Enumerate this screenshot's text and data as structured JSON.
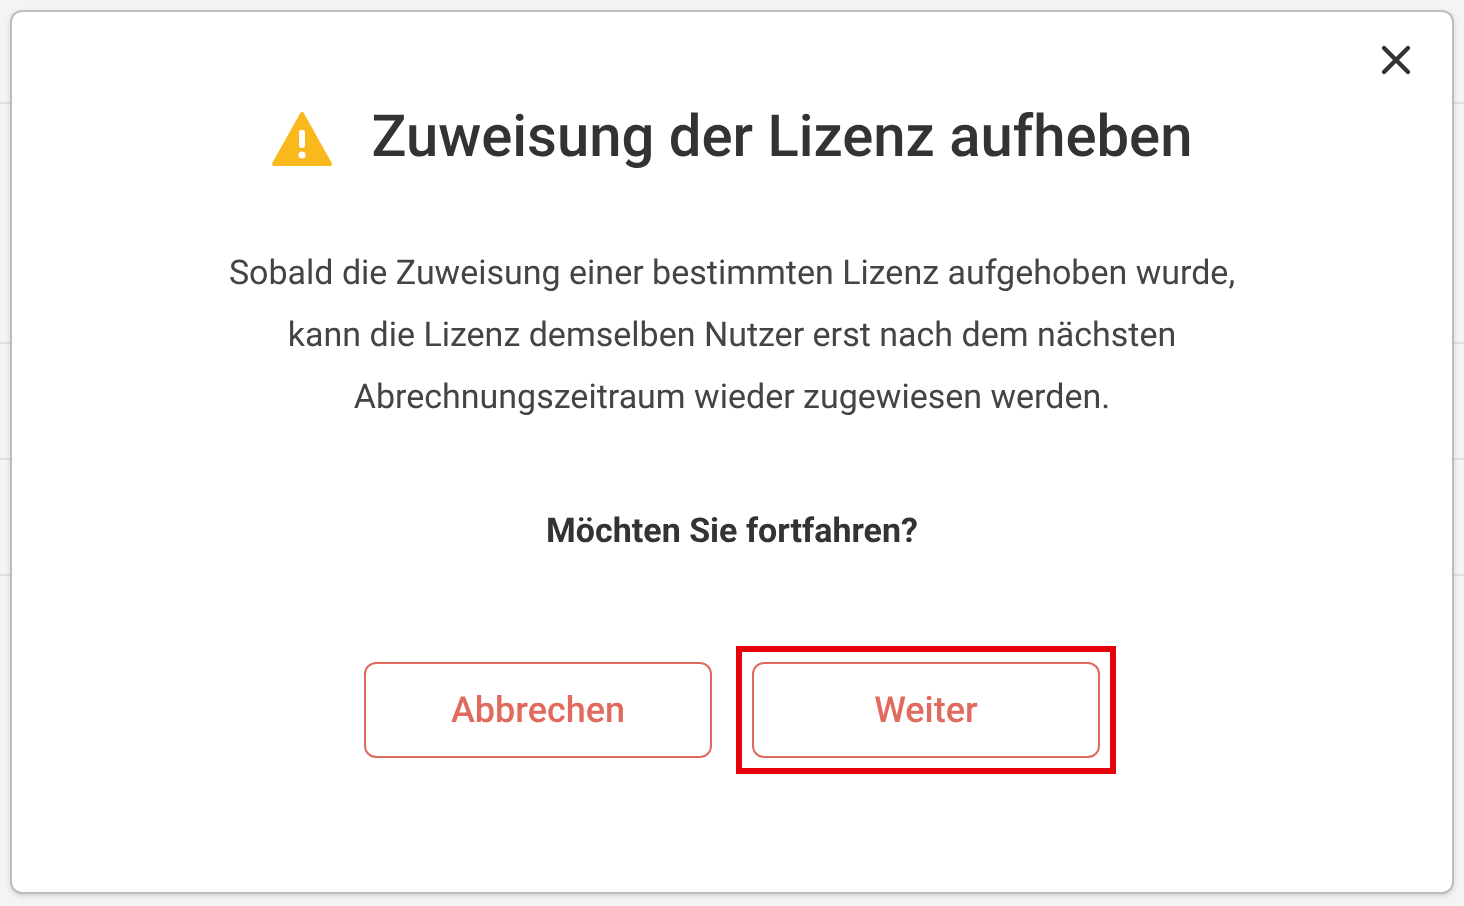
{
  "dialog": {
    "title": "Zuweisung der Lizenz aufheben",
    "message": "Sobald die Zuweisung einer bestimmten Lizenz aufgehoben wurde, kann die Lizenz demselben Nutzer erst nach dem nächsten Abrechnungszeitraum wieder zugewiesen werden.",
    "question": "Möchten Sie fortfahren?",
    "buttons": [
      {
        "label": "Abbrechen",
        "highlighted": false
      },
      {
        "label": "Weiter",
        "highlighted": true
      }
    ]
  }
}
